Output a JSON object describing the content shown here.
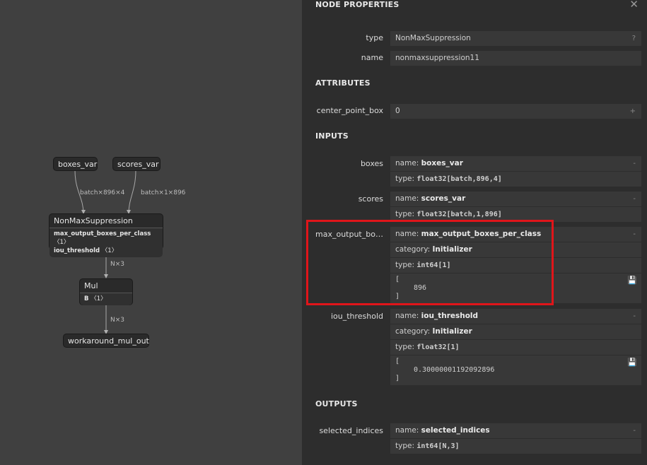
{
  "graph": {
    "nodes": {
      "boxes_var": "boxes_var",
      "scores_var": "scores_var",
      "nms": "NonMaxSuppression",
      "nms_attr1": "max_output_boxes_per_class",
      "nms_attr1_val": "〈1〉",
      "nms_attr2": "iou_threshold",
      "nms_attr2_val": "〈1〉",
      "mul": "Mul",
      "mul_attr": "B",
      "mul_attr_val": "〈1〉",
      "out": "workaround_mul_out"
    },
    "edges": {
      "boxes": "batch×896×4",
      "scores": "batch×1×896",
      "nms_out": "N×3",
      "mul_out": "N×3"
    }
  },
  "panel": {
    "title": "NODE PROPERTIES",
    "close": "✕",
    "type_label": "type",
    "type_value": "NonMaxSuppression",
    "type_help": "?",
    "name_label": "name",
    "name_value": "nonmaxsuppression11",
    "attributes_header": "ATTRIBUTES",
    "center_label": "center_point_box",
    "center_value": "0",
    "center_toggle": "+",
    "inputs_header": "INPUTS",
    "outputs_header": "OUTPUTS",
    "name_key": "name: ",
    "type_key": "type: ",
    "category_key": "category: ",
    "minus": "-",
    "save": "💾",
    "open_bracket": "[",
    "close_bracket": "]",
    "inputs": {
      "boxes": {
        "label": "boxes",
        "name": "boxes_var",
        "type": "float32[batch,896,4]"
      },
      "scores": {
        "label": "scores",
        "name": "scores_var",
        "type": "float32[batch,1,896]"
      },
      "max": {
        "label": "max_output_bo…",
        "name": "max_output_boxes_per_class",
        "category": "Initializer",
        "type": "int64[1]",
        "value": "896"
      },
      "iou": {
        "label": "iou_threshold",
        "name": "iou_threshold",
        "category": "Initializer",
        "type": "float32[1]",
        "value": "0.30000001192092896"
      }
    },
    "outputs": {
      "selected": {
        "label": "selected_indices",
        "name": "selected_indices",
        "type": "int64[N,3]"
      }
    }
  }
}
